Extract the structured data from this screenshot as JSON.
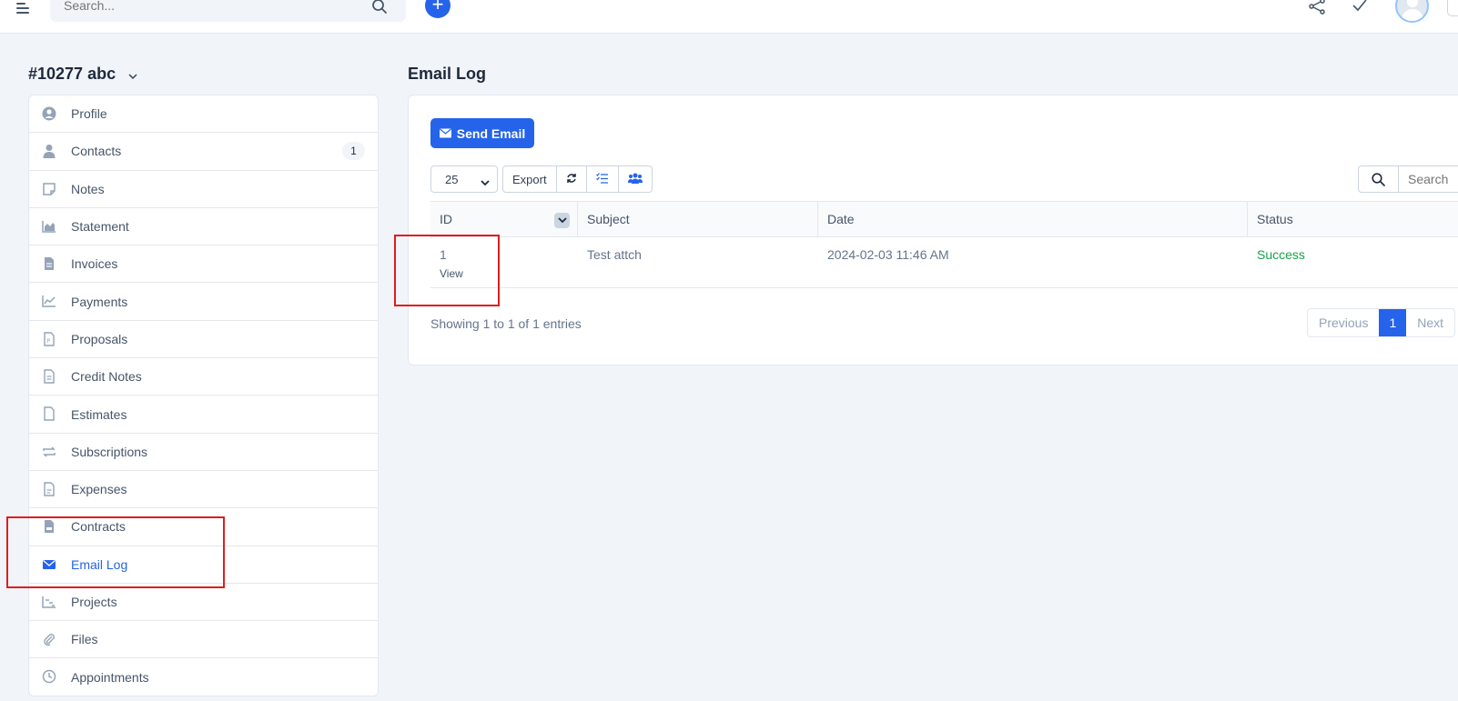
{
  "topbar": {
    "search_placeholder": "Search..."
  },
  "client": {
    "title": "#10277 abc"
  },
  "sidebar": {
    "items": [
      {
        "label": "Profile",
        "icon": "user-circle-icon"
      },
      {
        "label": "Contacts",
        "icon": "user-icon",
        "badge": "1"
      },
      {
        "label": "Notes",
        "icon": "sticky-note-icon"
      },
      {
        "label": "Statement",
        "icon": "area-chart-icon"
      },
      {
        "label": "Invoices",
        "icon": "file-invoice-icon"
      },
      {
        "label": "Payments",
        "icon": "line-chart-icon"
      },
      {
        "label": "Proposals",
        "icon": "file-proposal-icon"
      },
      {
        "label": "Credit Notes",
        "icon": "file-lines-icon"
      },
      {
        "label": "Estimates",
        "icon": "file-icon"
      },
      {
        "label": "Subscriptions",
        "icon": "repeat-icon"
      },
      {
        "label": "Expenses",
        "icon": "file-expense-icon"
      },
      {
        "label": "Contracts",
        "icon": "file-contract-icon"
      },
      {
        "label": "Email Log",
        "icon": "envelope-icon",
        "active": true
      },
      {
        "label": "Projects",
        "icon": "chart-gantt-icon"
      },
      {
        "label": "Files",
        "icon": "paperclip-icon"
      },
      {
        "label": "Appointments",
        "icon": "clock-icon"
      }
    ]
  },
  "main": {
    "title": "Email Log",
    "send_button": "Send Email",
    "page_length": "25",
    "export_label": "Export",
    "table_search_placeholder": "Search",
    "columns": [
      "ID",
      "Subject",
      "Date",
      "Status"
    ],
    "rows": [
      {
        "id": "1",
        "view": "View",
        "subject": "Test attch",
        "date": "2024-02-03 11:46 AM",
        "status": "Success"
      }
    ],
    "info": "Showing 1 to 1 of 1 entries",
    "pager": {
      "prev": "Previous",
      "current": "1",
      "next": "Next"
    }
  },
  "colors": {
    "accent": "#2563eb",
    "success": "#16a34a",
    "highlight": "#e11d1d"
  }
}
